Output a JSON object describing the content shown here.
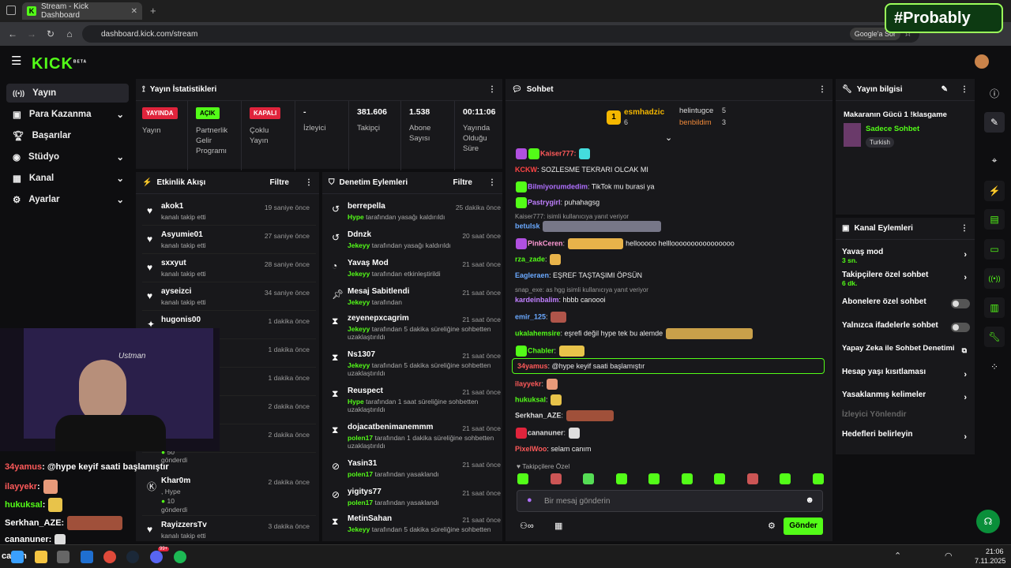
{
  "browser": {
    "tab_title": "Stream - Kick Dashboard",
    "url": "dashboard.kick.com/stream",
    "google_chip": "Google'a Sor"
  },
  "overlay_brand": "#Probably",
  "logo": "KICK",
  "logo_beta": "BETA",
  "sidebar": {
    "items": [
      {
        "label": "Yayın"
      },
      {
        "label": "Para Kazanma"
      },
      {
        "label": "Başarılar"
      },
      {
        "label": "Stüdyo"
      },
      {
        "label": "Kanal"
      },
      {
        "label": "Ayarlar"
      }
    ]
  },
  "stats": {
    "title": "Yayın İstatistikleri",
    "items": [
      {
        "badge": "YAYINDA",
        "label": "Yayın"
      },
      {
        "badge": "AÇIK",
        "label": "Partnerlik Gelir Programı"
      },
      {
        "badge": "KAPALI",
        "label": "Çoklu Yayın"
      },
      {
        "value": "-",
        "label": "İzleyici"
      },
      {
        "value": "381.606",
        "label": "Takipçi"
      },
      {
        "value": "1.538",
        "label": "Abone Sayısı"
      },
      {
        "value": "00:11:06",
        "label": "Yayında Olduğu Süre"
      }
    ]
  },
  "activity": {
    "title": "Etkinlik Akışı",
    "filter": "Filtre",
    "items": [
      {
        "name": "akok1",
        "sub": "kanalı takip etti",
        "time": "19 saniye önce"
      },
      {
        "name": "Asyumie01",
        "sub": "kanalı takip etti",
        "time": "27 saniye önce"
      },
      {
        "name": "sxxyut",
        "sub": "kanalı takip etti",
        "time": "28 saniye önce"
      },
      {
        "name": "ayseizci",
        "sub": "kanalı takip etti",
        "time": "34 saniye önce"
      },
      {
        "name": "hugonis00",
        "sub": "",
        "time": "1 dakika önce"
      },
      {
        "name": "",
        "sub": "",
        "time": "1 dakika önce"
      },
      {
        "name": "",
        "sub": "",
        "time": "1 dakika önce"
      },
      {
        "name": "",
        "sub": "",
        "time": "2 dakika önce"
      },
      {
        "name": "",
        "sub": "",
        "time": "2 dakika önce"
      }
    ],
    "khar": {
      "name": "Khar0m",
      "sub1": ", Hype",
      "sub2": "10",
      "sub3": "gönderdi",
      "time": "2 dakika önce"
    },
    "partial": {
      "sub2": "50",
      "sub3": "gönderdi"
    },
    "rayiz": {
      "name": "RayizzersTv",
      "sub": "kanalı takip etti",
      "time": "3 dakika önce"
    }
  },
  "moderation": {
    "title": "Denetim Eylemleri",
    "filter": "Filtre",
    "items": [
      {
        "name": "berrepella",
        "by": "Hype",
        "rest": " tarafından yasağı kaldırıldı",
        "time": "25 dakika önce"
      },
      {
        "name": "Ddnzk",
        "by": "Jekeyy",
        "rest": " tarafından yasağı kaldırıldı",
        "time": "20 saat önce"
      },
      {
        "name": "Yavaş Mod",
        "by": "Jekeyy",
        "rest": " tarafından etkinleştirildi",
        "time": "21 saat önce"
      },
      {
        "name": "Mesaj Sabitlendi",
        "by": "Jekeyy",
        "rest": " tarafından",
        "time": "21 saat önce"
      },
      {
        "name": "zeyenepxcagrim",
        "by": "Jekeyy",
        "rest": " tarafından 5 dakika süreliğine sohbetten uzaklaştırıldı",
        "time": "21 saat önce"
      },
      {
        "name": "Ns1307",
        "by": "Jekeyy",
        "rest": " tarafından 5 dakika süreliğine sohbetten uzaklaştırıldı",
        "time": "21 saat önce"
      },
      {
        "name": "Reuspect",
        "by": "Hype",
        "rest": " tarafından 1 saat süreliğine sohbetten uzaklaştırıldı",
        "time": "21 saat önce"
      },
      {
        "name": "dojacatbenimanemmm",
        "by": "polen17",
        "rest": " tarafından 1 dakika süreliğine sohbetten uzaklaştırıldı",
        "time": "21 saat önce"
      },
      {
        "name": "Yasin31",
        "by": "polen17",
        "rest": " tarafından yasaklandı",
        "time": "21 saat önce"
      },
      {
        "name": "yigitys77",
        "by": "polen17",
        "rest": " tarafından yasaklandı",
        "time": "21 saat önce"
      },
      {
        "name": "MetinSahan",
        "by": "Jekeyy",
        "rest": " tarafından 5 dakika süreliğine sohbetten",
        "time": "21 saat önce"
      }
    ]
  },
  "chat": {
    "title": "Sohbet",
    "top": {
      "rank": "1",
      "name": "esmhadzic",
      "count": "6",
      "second": "helintugce",
      "second_count": "5",
      "third": "benbildim",
      "third_count": "3"
    },
    "messages": [
      {
        "user": "Kaiser777:",
        "color": "#ff5a5a",
        "text": ""
      },
      {
        "user": "KCKW",
        "color": "#ff4444",
        "text": ": SOZLESME TEKRARI OLCAK MI"
      },
      {
        "user": "Bilmiyorumdedim",
        "color": "#b070ff",
        "text": ": TikTok mu burasi ya"
      },
      {
        "user": "Pastrygirl",
        "color": "#c080ff",
        "text": ": puhahagsg"
      },
      {
        "user": "betulsk",
        "color": "#6aa9ff",
        "text": ":"
      },
      {
        "user": "PinkCeren",
        "color": "#ff9ad5",
        "text": ":",
        "tail": "hellooooo hellloooooooooooooooo"
      },
      {
        "user": "rza_zade",
        "color": "#53fc18",
        "text": ":"
      },
      {
        "user": "Eagleraen",
        "color": "#6aa9ff",
        "text": ": EŞREF TAŞTAŞIMI ÖPSÜN"
      },
      {
        "user": "kardeinbalim",
        "color": "#c080ff",
        "text": ": hbbb canoooi"
      },
      {
        "user": "emir_125",
        "color": "#6aa9ff",
        "text": ":"
      },
      {
        "user": "ukalahemsire",
        "color": "#53fc18",
        "text": ": eşrefi değil hype tek bu alemde"
      },
      {
        "user": "Chabler",
        "color": "#53fc18",
        "text": ":"
      },
      {
        "user": "34yamus",
        "color": "#ff5a5a",
        "text": ": @hype keyif saati başlamıştır"
      },
      {
        "user": "ilayyekr",
        "color": "#ff5a5a",
        "text": ":"
      },
      {
        "user": "hukuksal",
        "color": "#53fc18",
        "text": ":"
      },
      {
        "user": "Serkhan_AZE",
        "color": "#ddd",
        "text": ":"
      },
      {
        "user": "cananuner",
        "color": "#ddd",
        "text": ":"
      },
      {
        "user": "PixelWoo",
        "color": "#ff5a5a",
        "text": ": selam canım"
      }
    ],
    "reply1": "Kaiser777:                    isimli kullanıcıya yanıt veriyor",
    "reply2": "snap_exe: as hgg isimli kullanıcıya yanıt veriyor",
    "followers_only": "Takipçilere Özel",
    "placeholder": "Bir mesaj gönderin",
    "send": "Gönder"
  },
  "stream_info": {
    "title": "Yayın bilgisi",
    "name": "Makaranın Gücü 1 !klasgame",
    "category": "Sadece Sohbet",
    "tag": "Turkish"
  },
  "channel_actions": {
    "title": "Kanal Eylemleri",
    "items": [
      {
        "label": "Yavaş mod",
        "sub": "3 sn."
      },
      {
        "label": "Takipçilere özel sohbet",
        "sub": "6 dk."
      },
      {
        "label": "Abonelere özel sohbet"
      },
      {
        "label": "Yalnızca ifadelerle sohbet"
      },
      {
        "label": "Yapay Zeka ile Sohbet Denetimi"
      },
      {
        "label": "Hesap yaşı kısıtlaması"
      },
      {
        "label": "Yasaklanmış kelimeler"
      },
      {
        "label": "İzleyici Yönlendir"
      },
      {
        "label": "Hedefleri belirleyin"
      }
    ]
  },
  "overlay_chat": [
    {
      "user": "34yamus",
      "text": ": @hype keyif saati başlamıştır"
    },
    {
      "user": "ilayyekr",
      "text": ":"
    },
    {
      "user": "hukuksal",
      "text": ":"
    },
    {
      "user": "Serkhan_AZE",
      "text": ":"
    },
    {
      "user": "cananuner",
      "text": ":"
    }
  ],
  "overlay_bottom": "canım",
  "cam_text": "Ustman",
  "taskbar": {
    "time": "21:06",
    "date": "7.11.2025",
    "notif": "99+"
  }
}
